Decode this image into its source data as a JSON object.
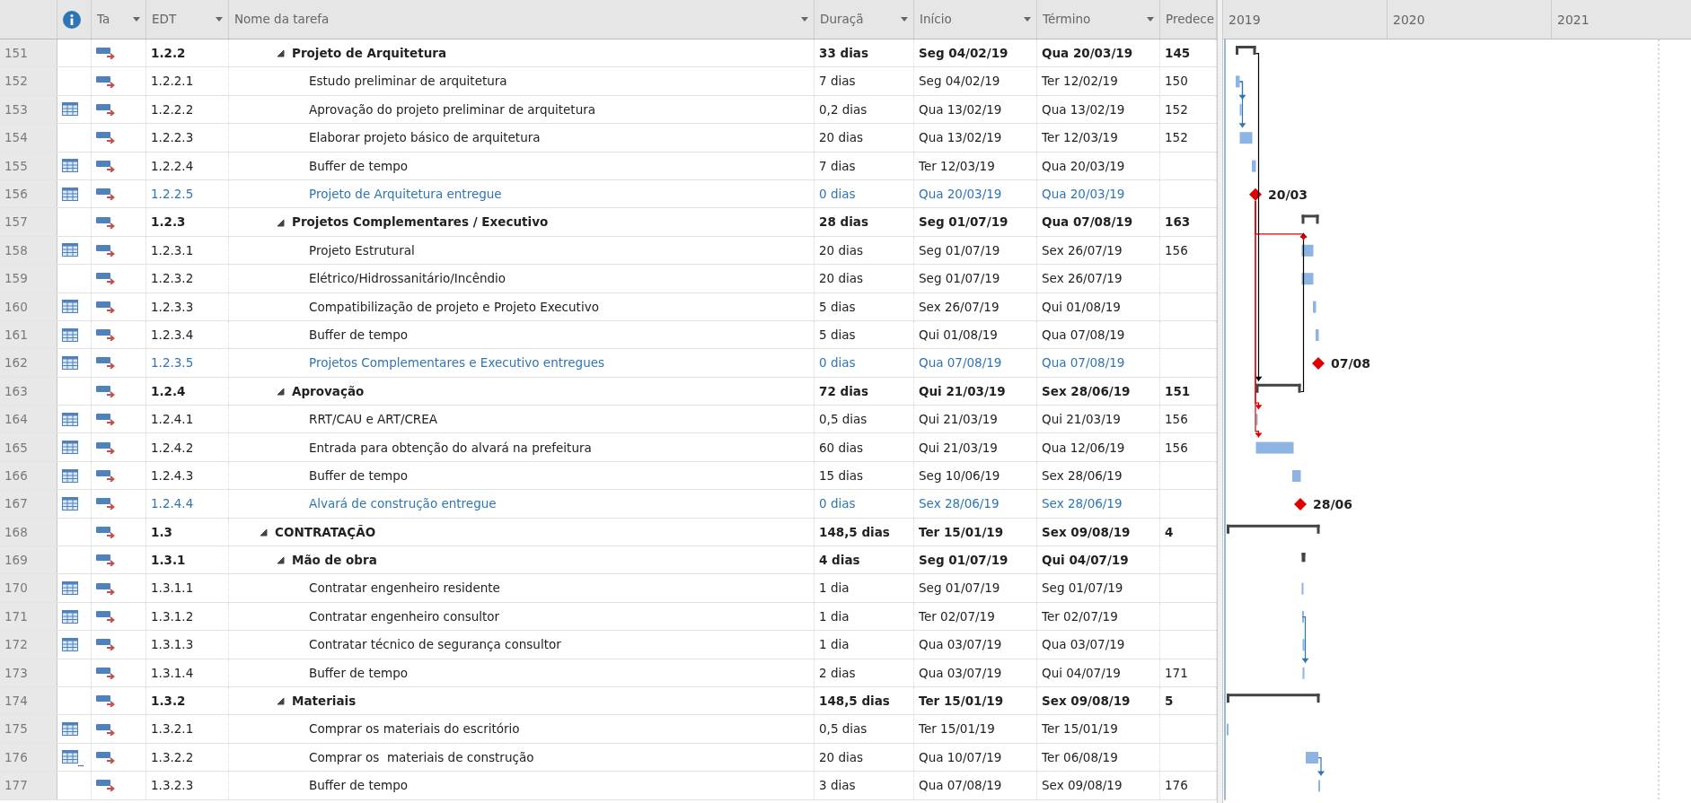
{
  "columns": {
    "mode": "Ta",
    "wbs": "EDT",
    "name": "Nome da tarefa",
    "duration": "Duraçã",
    "start": "Início",
    "finish": "Término",
    "predecessors": "Predece"
  },
  "timescale": [
    {
      "label": "2019"
    },
    {
      "label": "2020"
    },
    {
      "label": "2021"
    }
  ],
  "rows": [
    {
      "children": [
        {
          "id": "151",
          "kind": "summary",
          "expanded": true,
          "calendar": false,
          "notes": false,
          "wbs": "1.2.2",
          "name": "Projeto de Arquitetura",
          "duration": "33 dias",
          "start": "Seg 04/02/19",
          "finish": "Qua 20/03/19",
          "predecessors": "145",
          "children": [
            {
              "id": "152",
              "kind": "task",
              "calendar": false,
              "notes": false,
              "wbs": "1.2.2.1",
              "name": "Estudo preliminar de arquitetura",
              "duration": "7 dias",
              "start": "Seg 04/02/19",
              "finish": "Ter 12/02/19",
              "predecessors": "150"
            },
            {
              "id": "153",
              "kind": "task",
              "calendar": true,
              "notes": false,
              "wbs": "1.2.2.2",
              "name": "Aprovação do projeto preliminar de arquitetura",
              "duration": "0,2 dias",
              "start": "Qua 13/02/19",
              "finish": "Qua 13/02/19",
              "predecessors": "152"
            },
            {
              "id": "154",
              "kind": "task",
              "calendar": false,
              "notes": false,
              "wbs": "1.2.2.3",
              "name": "Elaborar projeto básico de arquitetura",
              "duration": "20 dias",
              "start": "Qua 13/02/19",
              "finish": "Ter 12/03/19",
              "predecessors": "152"
            },
            {
              "id": "155",
              "kind": "task",
              "calendar": true,
              "notes": false,
              "wbs": "1.2.2.4",
              "name": "Buffer de tempo",
              "duration": "7 dias",
              "start": "Ter 12/03/19",
              "finish": "Qua 20/03/19"
            },
            {
              "id": "156",
              "kind": "milestone",
              "calendar": true,
              "notes": false,
              "wbs": "1.2.2.5",
              "name": "Projeto de Arquitetura entregue",
              "duration": "0 dias",
              "start": "Qua 20/03/19",
              "finish": "Qua 20/03/19",
              "bar_label": "20/03"
            }
          ]
        },
        {
          "id": "157",
          "kind": "summary",
          "expanded": true,
          "calendar": false,
          "notes": false,
          "wbs": "1.2.3",
          "name": "Projetos Complementares / Executivo",
          "duration": "28 dias",
          "start": "Seg 01/07/19",
          "finish": "Qua 07/08/19",
          "predecessors": "163",
          "children": [
            {
              "id": "158",
              "kind": "task",
              "calendar": true,
              "notes": false,
              "wbs": "1.2.3.1",
              "name": "Projeto Estrutural",
              "duration": "20 dias",
              "start": "Seg 01/07/19",
              "finish": "Sex 26/07/19",
              "predecessors": "156"
            },
            {
              "id": "159",
              "kind": "task",
              "calendar": false,
              "notes": false,
              "wbs": "1.2.3.2",
              "name": "Elétrico/Hidrossanitário/Incêndio",
              "duration": "20 dias",
              "start": "Seg 01/07/19",
              "finish": "Sex 26/07/19"
            },
            {
              "id": "160",
              "kind": "task",
              "calendar": true,
              "notes": false,
              "wbs": "1.2.3.3",
              "name": "Compatibilização de projeto e Projeto Executivo",
              "duration": "5 dias",
              "start": "Sex 26/07/19",
              "finish": "Qui 01/08/19"
            },
            {
              "id": "161",
              "kind": "task",
              "calendar": true,
              "notes": false,
              "wbs": "1.2.3.4",
              "name": "Buffer de tempo",
              "duration": "5 dias",
              "start": "Qui 01/08/19",
              "finish": "Qua 07/08/19"
            },
            {
              "id": "162",
              "kind": "milestone",
              "calendar": true,
              "notes": false,
              "wbs": "1.2.3.5",
              "name": "Projetos Complementares e Executivo entregues",
              "duration": "0 dias",
              "start": "Qua 07/08/19",
              "finish": "Qua 07/08/19",
              "bar_label": "07/08"
            }
          ]
        },
        {
          "id": "163",
          "kind": "summary",
          "expanded": true,
          "calendar": false,
          "notes": false,
          "wbs": "1.2.4",
          "name": "Aprovação",
          "duration": "72 dias",
          "start": "Qui 21/03/19",
          "finish": "Sex 28/06/19",
          "predecessors": "151",
          "children": [
            {
              "id": "164",
              "kind": "task",
              "calendar": true,
              "notes": false,
              "wbs": "1.2.4.1",
              "name": "RRT/CAU e ART/CREA",
              "duration": "0,5 dias",
              "start": "Qui 21/03/19",
              "finish": "Qui 21/03/19",
              "predecessors": "156"
            },
            {
              "id": "165",
              "kind": "task",
              "calendar": true,
              "notes": false,
              "wbs": "1.2.4.2",
              "name": "Entrada para obtenção do alvará na prefeitura",
              "duration": "60 dias",
              "start": "Qui 21/03/19",
              "finish": "Qua 12/06/19",
              "predecessors": "156"
            },
            {
              "id": "166",
              "kind": "task",
              "calendar": true,
              "notes": false,
              "wbs": "1.2.4.3",
              "name": "Buffer de tempo",
              "duration": "15 dias",
              "start": "Seg 10/06/19",
              "finish": "Sex 28/06/19"
            },
            {
              "id": "167",
              "kind": "milestone",
              "calendar": true,
              "notes": false,
              "wbs": "1.2.4.4",
              "name": "Alvará de construção entregue",
              "duration": "0 dias",
              "start": "Sex 28/06/19",
              "finish": "Sex 28/06/19",
              "bar_label": "28/06"
            }
          ]
        }
      ]
    },
    {
      "id": "168",
      "kind": "summary",
      "expanded": true,
      "calendar": false,
      "notes": false,
      "wbs": "1.3",
      "name": "CONTRATAÇÃO",
      "duration": "148,5 dias",
      "start": "Ter 15/01/19",
      "finish": "Sex 09/08/19",
      "predecessors": "4",
      "children": [
        {
          "id": "169",
          "kind": "summary",
          "expanded": true,
          "calendar": false,
          "notes": false,
          "wbs": "1.3.1",
          "name": "Mão de obra",
          "duration": "4 dias",
          "start": "Seg 01/07/19",
          "finish": "Qui 04/07/19",
          "children": [
            {
              "id": "170",
              "kind": "task",
              "calendar": true,
              "notes": false,
              "wbs": "1.3.1.1",
              "name": "Contratar engenheiro residente",
              "duration": "1 dia",
              "start": "Seg 01/07/19",
              "finish": "Seg 01/07/19"
            },
            {
              "id": "171",
              "kind": "task",
              "calendar": true,
              "notes": false,
              "wbs": "1.3.1.2",
              "name": "Contratar engenheiro consultor",
              "duration": "1 dia",
              "start": "Ter 02/07/19",
              "finish": "Ter 02/07/19"
            },
            {
              "id": "172",
              "kind": "task",
              "calendar": true,
              "notes": false,
              "wbs": "1.3.1.3",
              "name": "Contratar técnico de segurança consultor",
              "duration": "1 dia",
              "start": "Qua 03/07/19",
              "finish": "Qua 03/07/19"
            },
            {
              "id": "173",
              "kind": "task",
              "calendar": false,
              "notes": false,
              "wbs": "1.3.1.4",
              "name": "Buffer de tempo",
              "duration": "2 dias",
              "start": "Qua 03/07/19",
              "finish": "Qui 04/07/19",
              "predecessors": "171"
            }
          ]
        },
        {
          "id": "174",
          "kind": "summary",
          "expanded": true,
          "calendar": false,
          "notes": false,
          "wbs": "1.3.2",
          "name": "Materiais",
          "duration": "148,5 dias",
          "start": "Ter 15/01/19",
          "finish": "Sex 09/08/19",
          "predecessors": "5",
          "children": [
            {
              "id": "175",
              "kind": "task",
              "calendar": true,
              "notes": false,
              "wbs": "1.3.2.1",
              "name": "Comprar os materiais do escritório",
              "duration": "0,5 dias",
              "start": "Ter 15/01/19",
              "finish": "Ter 15/01/19"
            },
            {
              "id": "176",
              "kind": "task",
              "calendar": true,
              "notes": true,
              "wbs": "1.3.2.2",
              "name": "Comprar os  materiais de construção",
              "duration": "20 dias",
              "start": "Qua 10/07/19",
              "finish": "Ter 06/08/19"
            },
            {
              "id": "177",
              "kind": "task",
              "calendar": false,
              "notes": false,
              "wbs": "1.3.2.3",
              "name": "Buffer de tempo",
              "duration": "3 dias",
              "start": "Qua 07/08/19",
              "finish": "Sex 09/08/19",
              "predecessors": "176"
            }
          ]
        }
      ]
    }
  ]
}
